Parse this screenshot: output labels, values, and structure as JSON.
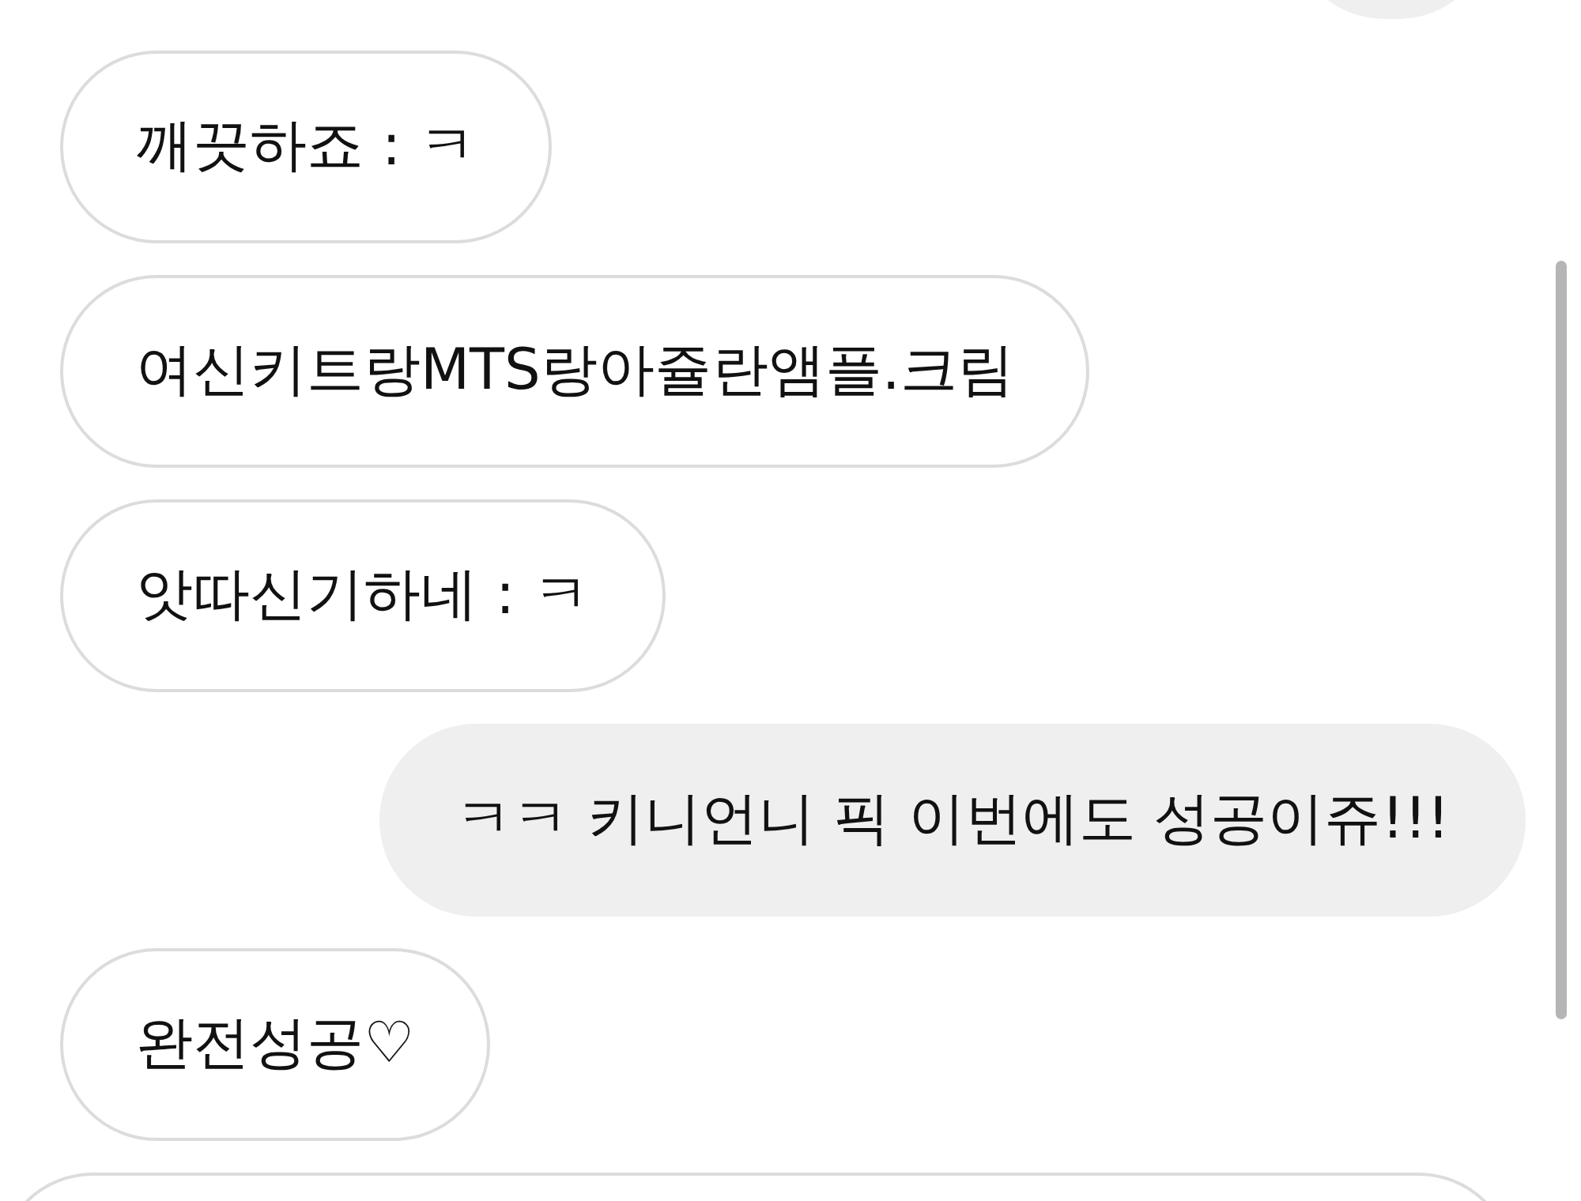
{
  "messages": [
    {
      "kind": "sent"
    },
    {
      "kind": "received",
      "text": "깨끗하죠 : ㅋ"
    },
    {
      "kind": "received",
      "text": "여신키트랑MTS랑아쥴란앰플.크림"
    },
    {
      "kind": "received",
      "text": "앗따신기하네 : ㅋ"
    },
    {
      "kind": "sent",
      "text": "ㅋㅋ 키니언니 픽 이번에도 성공이쥬!!!"
    },
    {
      "kind": "received",
      "text": "완전성공♡"
    },
    {
      "kind": "received"
    }
  ]
}
